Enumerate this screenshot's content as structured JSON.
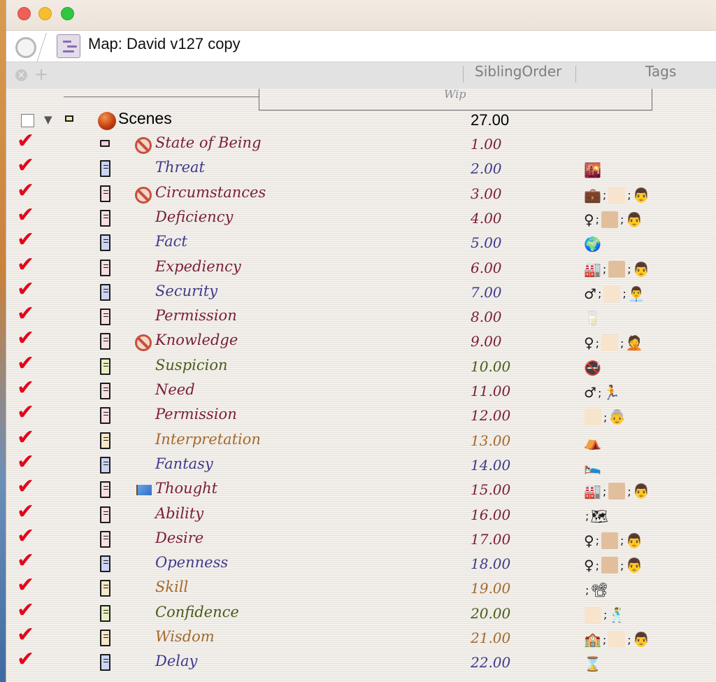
{
  "window": {
    "tab_title": "Map: David v127 copy"
  },
  "toolbar": {
    "close_glyph": "×",
    "add_glyph": "+",
    "col_siblingorder": "SiblingOrder",
    "col_tags": "Tags",
    "wip_label": "Wip"
  },
  "colors": {
    "maroon": "#7a1e35",
    "indigo": "#3f3a8a",
    "olive": "#495c18",
    "tan": "#a3692a",
    "check_red": "#e2071b"
  },
  "root": {
    "checked": false,
    "name": "Scenes",
    "order": "27.00"
  },
  "rows": [
    {
      "name": "State of Being",
      "order": "1.00",
      "color": "#7a1e35",
      "badge": "no-entry",
      "note": "small",
      "note_fill": "#f4d2d9",
      "tags": []
    },
    {
      "name": "Threat",
      "order": "2.00",
      "color": "#3f3a8a",
      "badge": "",
      "note": "tall",
      "note_fill": "#ccd4f2",
      "tags": [
        {
          "kind": "glyph",
          "icon": "sunset-cityscape-icon",
          "glyph": "🌇"
        }
      ]
    },
    {
      "name": "Circumstances",
      "order": "3.00",
      "color": "#7a1e35",
      "badge": "no-entry",
      "note": "tall",
      "note_fill": "#f6dfe3",
      "tags": [
        {
          "kind": "glyph",
          "icon": "briefcase-icon",
          "glyph": "💼"
        },
        {
          "kind": "sep",
          "glyph": ";"
        },
        {
          "kind": "swatch",
          "color": "#f8e3cc"
        },
        {
          "kind": "sep",
          "glyph": ";"
        },
        {
          "kind": "glyph",
          "icon": "man-icon",
          "glyph": "👨"
        }
      ]
    },
    {
      "name": "Deficiency",
      "order": "4.00",
      "color": "#7a1e35",
      "badge": "",
      "note": "tall",
      "note_fill": "#f6dfe3",
      "tags": [
        {
          "kind": "glyph",
          "icon": "female-sign-icon",
          "glyph": "♀"
        },
        {
          "kind": "sep",
          "glyph": ";"
        },
        {
          "kind": "swatch",
          "color": "#e2bf9c"
        },
        {
          "kind": "sep",
          "glyph": ";"
        },
        {
          "kind": "glyph",
          "icon": "man-icon",
          "glyph": "👨"
        }
      ]
    },
    {
      "name": "Fact",
      "order": "5.00",
      "color": "#3f3a8a",
      "badge": "",
      "note": "tall",
      "note_fill": "#ccd4f2",
      "tags": [
        {
          "kind": "glyph",
          "icon": "globe-icon",
          "glyph": "🌍"
        }
      ]
    },
    {
      "name": "Expediency",
      "order": "6.00",
      "color": "#7a1e35",
      "badge": "",
      "note": "tall",
      "note_fill": "#f6dfe3",
      "tags": [
        {
          "kind": "glyph",
          "icon": "factory-icon",
          "glyph": "🏭"
        },
        {
          "kind": "sep",
          "glyph": ";"
        },
        {
          "kind": "swatch",
          "color": "#e2bf9c"
        },
        {
          "kind": "sep",
          "glyph": ";"
        },
        {
          "kind": "glyph",
          "icon": "man-icon",
          "glyph": "👨"
        }
      ]
    },
    {
      "name": "Security",
      "order": "7.00",
      "color": "#3f3a8a",
      "badge": "",
      "note": "tall",
      "note_fill": "#ccd4f2",
      "tags": [
        {
          "kind": "glyph",
          "icon": "male-sign-icon",
          "glyph": "♂"
        },
        {
          "kind": "sep",
          "glyph": ";"
        },
        {
          "kind": "swatch",
          "color": "#f8e3cc"
        },
        {
          "kind": "sep",
          "glyph": ";"
        },
        {
          "kind": "glyph",
          "icon": "office-worker-icon",
          "glyph": "👨‍💼"
        }
      ]
    },
    {
      "name": "Permission",
      "order": "8.00",
      "color": "#7a1e35",
      "badge": "",
      "note": "tall",
      "note_fill": "#f6dfe3",
      "tags": [
        {
          "kind": "glyph",
          "icon": "glass-of-milk-icon",
          "glyph": "🥛"
        }
      ]
    },
    {
      "name": "Knowledge",
      "order": "9.00",
      "color": "#7a1e35",
      "badge": "no-entry",
      "note": "tall",
      "note_fill": "#f6dfe3",
      "tags": [
        {
          "kind": "glyph",
          "icon": "female-sign-icon",
          "glyph": "♀"
        },
        {
          "kind": "sep",
          "glyph": ";"
        },
        {
          "kind": "swatch",
          "color": "#f8e3cc"
        },
        {
          "kind": "sep",
          "glyph": ";"
        },
        {
          "kind": "glyph",
          "icon": "face-palm-icon",
          "glyph": "🤦"
        }
      ]
    },
    {
      "name": "Suspicion",
      "order": "10.00",
      "color": "#495c18",
      "badge": "",
      "note": "tall",
      "note_fill": "#e9efc2",
      "tags": [
        {
          "kind": "glyph",
          "icon": "no-smoking-icon",
          "glyph": "🚭"
        }
      ]
    },
    {
      "name": "Need",
      "order": "11.00",
      "color": "#7a1e35",
      "badge": "",
      "note": "tall",
      "note_fill": "#f6dfe3",
      "tags": [
        {
          "kind": "glyph",
          "icon": "male-sign-icon",
          "glyph": "♂"
        },
        {
          "kind": "sep",
          "glyph": ";"
        },
        {
          "kind": "glyph",
          "icon": "person-running-icon",
          "glyph": "🏃"
        }
      ]
    },
    {
      "name": "Permission",
      "order": "12.00",
      "color": "#7a1e35",
      "badge": "",
      "note": "tall",
      "note_fill": "#f6dfe3",
      "tags": [
        {
          "kind": "swatch",
          "color": "#f8e3cc"
        },
        {
          "kind": "sep",
          "glyph": ";"
        },
        {
          "kind": "glyph",
          "icon": "older-woman-icon",
          "glyph": "👵"
        }
      ]
    },
    {
      "name": "Interpretation",
      "order": "13.00",
      "color": "#a3692a",
      "badge": "",
      "note": "tall",
      "note_fill": "#f7e8c9",
      "tags": [
        {
          "kind": "glyph",
          "icon": "tent-icon",
          "glyph": "⛺"
        }
      ]
    },
    {
      "name": "Fantasy",
      "order": "14.00",
      "color": "#3f3a8a",
      "badge": "",
      "note": "tall",
      "note_fill": "#ccd4f2",
      "tags": [
        {
          "kind": "glyph",
          "icon": "person-in-bed-icon",
          "glyph": "🛌"
        }
      ]
    },
    {
      "name": "Thought",
      "order": "15.00",
      "color": "#7a1e35",
      "badge": "flag",
      "note": "tall",
      "note_fill": "#f6dfe3",
      "tags": [
        {
          "kind": "glyph",
          "icon": "factory-icon",
          "glyph": "🏭"
        },
        {
          "kind": "sep",
          "glyph": ";"
        },
        {
          "kind": "swatch",
          "color": "#e2bf9c"
        },
        {
          "kind": "sep",
          "glyph": ";"
        },
        {
          "kind": "glyph",
          "icon": "man-icon",
          "glyph": "👨"
        }
      ]
    },
    {
      "name": "Ability",
      "order": "16.00",
      "color": "#7a1e35",
      "badge": "",
      "note": "tall",
      "note_fill": "#f6dfe3",
      "tags": [
        {
          "kind": "sep",
          "glyph": ";"
        },
        {
          "kind": "glyph",
          "icon": "world-map-icon",
          "glyph": "🗺"
        }
      ]
    },
    {
      "name": "Desire",
      "order": "17.00",
      "color": "#7a1e35",
      "badge": "",
      "note": "tall",
      "note_fill": "#f6dfe3",
      "tags": [
        {
          "kind": "glyph",
          "icon": "female-sign-icon",
          "glyph": "♀"
        },
        {
          "kind": "sep",
          "glyph": ";"
        },
        {
          "kind": "swatch",
          "color": "#e2bf9c"
        },
        {
          "kind": "sep",
          "glyph": ";"
        },
        {
          "kind": "glyph",
          "icon": "man-icon",
          "glyph": "👨"
        }
      ]
    },
    {
      "name": "Openness",
      "order": "18.00",
      "color": "#3f3a8a",
      "badge": "",
      "note": "tall",
      "note_fill": "#ccd4f2",
      "tags": [
        {
          "kind": "glyph",
          "icon": "female-sign-icon",
          "glyph": "♀"
        },
        {
          "kind": "sep",
          "glyph": ";"
        },
        {
          "kind": "swatch",
          "color": "#e2bf9c"
        },
        {
          "kind": "sep",
          "glyph": ";"
        },
        {
          "kind": "glyph",
          "icon": "man-icon",
          "glyph": "👨"
        }
      ]
    },
    {
      "name": "Skill",
      "order": "19.00",
      "color": "#a3692a",
      "badge": "",
      "note": "tall",
      "note_fill": "#f7e8c9",
      "tags": [
        {
          "kind": "sep",
          "glyph": ";"
        },
        {
          "kind": "glyph",
          "icon": "film-projector-icon",
          "glyph": "📽"
        }
      ]
    },
    {
      "name": "Confidence",
      "order": "20.00",
      "color": "#495c18",
      "badge": "",
      "note": "tall",
      "note_fill": "#e9efc2",
      "tags": [
        {
          "kind": "swatch",
          "color": "#f8e3cc"
        },
        {
          "kind": "sep",
          "glyph": ";"
        },
        {
          "kind": "glyph",
          "icon": "man-dancing-icon",
          "glyph": "🕺"
        }
      ]
    },
    {
      "name": "Wisdom",
      "order": "21.00",
      "color": "#a3692a",
      "badge": "",
      "note": "tall",
      "note_fill": "#f7e8c9",
      "tags": [
        {
          "kind": "glyph",
          "icon": "school-building-icon",
          "glyph": "🏫"
        },
        {
          "kind": "sep",
          "glyph": ";"
        },
        {
          "kind": "swatch",
          "color": "#f8e3cc"
        },
        {
          "kind": "sep",
          "glyph": ";"
        },
        {
          "kind": "glyph",
          "icon": "man-icon",
          "glyph": "👨"
        }
      ]
    },
    {
      "name": "Delay",
      "order": "22.00",
      "color": "#3f3a8a",
      "badge": "",
      "note": "tall",
      "note_fill": "#ccd4f2",
      "tags": [
        {
          "kind": "glyph",
          "icon": "hourglass-icon",
          "glyph": "⌛"
        }
      ]
    }
  ]
}
